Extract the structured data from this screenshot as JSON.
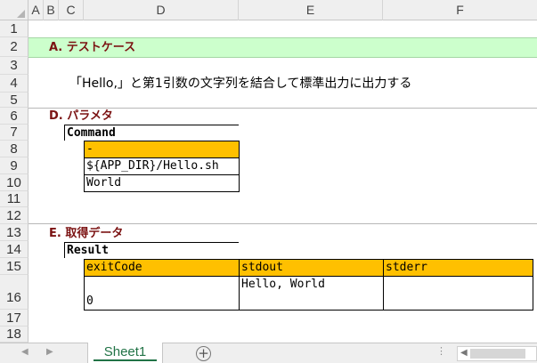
{
  "columns": [
    "A",
    "B",
    "C",
    "D",
    "E",
    "F"
  ],
  "rows": [
    "1",
    "2",
    "3",
    "4",
    "5",
    "6",
    "7",
    "8",
    "9",
    "10",
    "11",
    "12",
    "13",
    "14",
    "15",
    "16",
    "17",
    "18"
  ],
  "sectionA": {
    "title": "A. テストケース",
    "description": "「Hello,」と第1引数の文字列を結合して標準出力に出力する"
  },
  "sectionD": {
    "title": "D. パラメタ",
    "table_caption": "Command",
    "items": [
      "-",
      "${APP_DIR}/Hello.sh",
      "World"
    ]
  },
  "sectionE": {
    "title": "E. 取得データ",
    "table_caption": "Result",
    "headers": [
      "exitCode",
      "stdout",
      "stderr"
    ],
    "values": [
      "0",
      "Hello, World",
      ""
    ]
  },
  "sheets": [
    "Sheet1"
  ],
  "colors": {
    "band": "#ccffcc",
    "section_title": "#7b1212",
    "table_header": "#ffc000",
    "sheet_tab_text": "#217346"
  }
}
